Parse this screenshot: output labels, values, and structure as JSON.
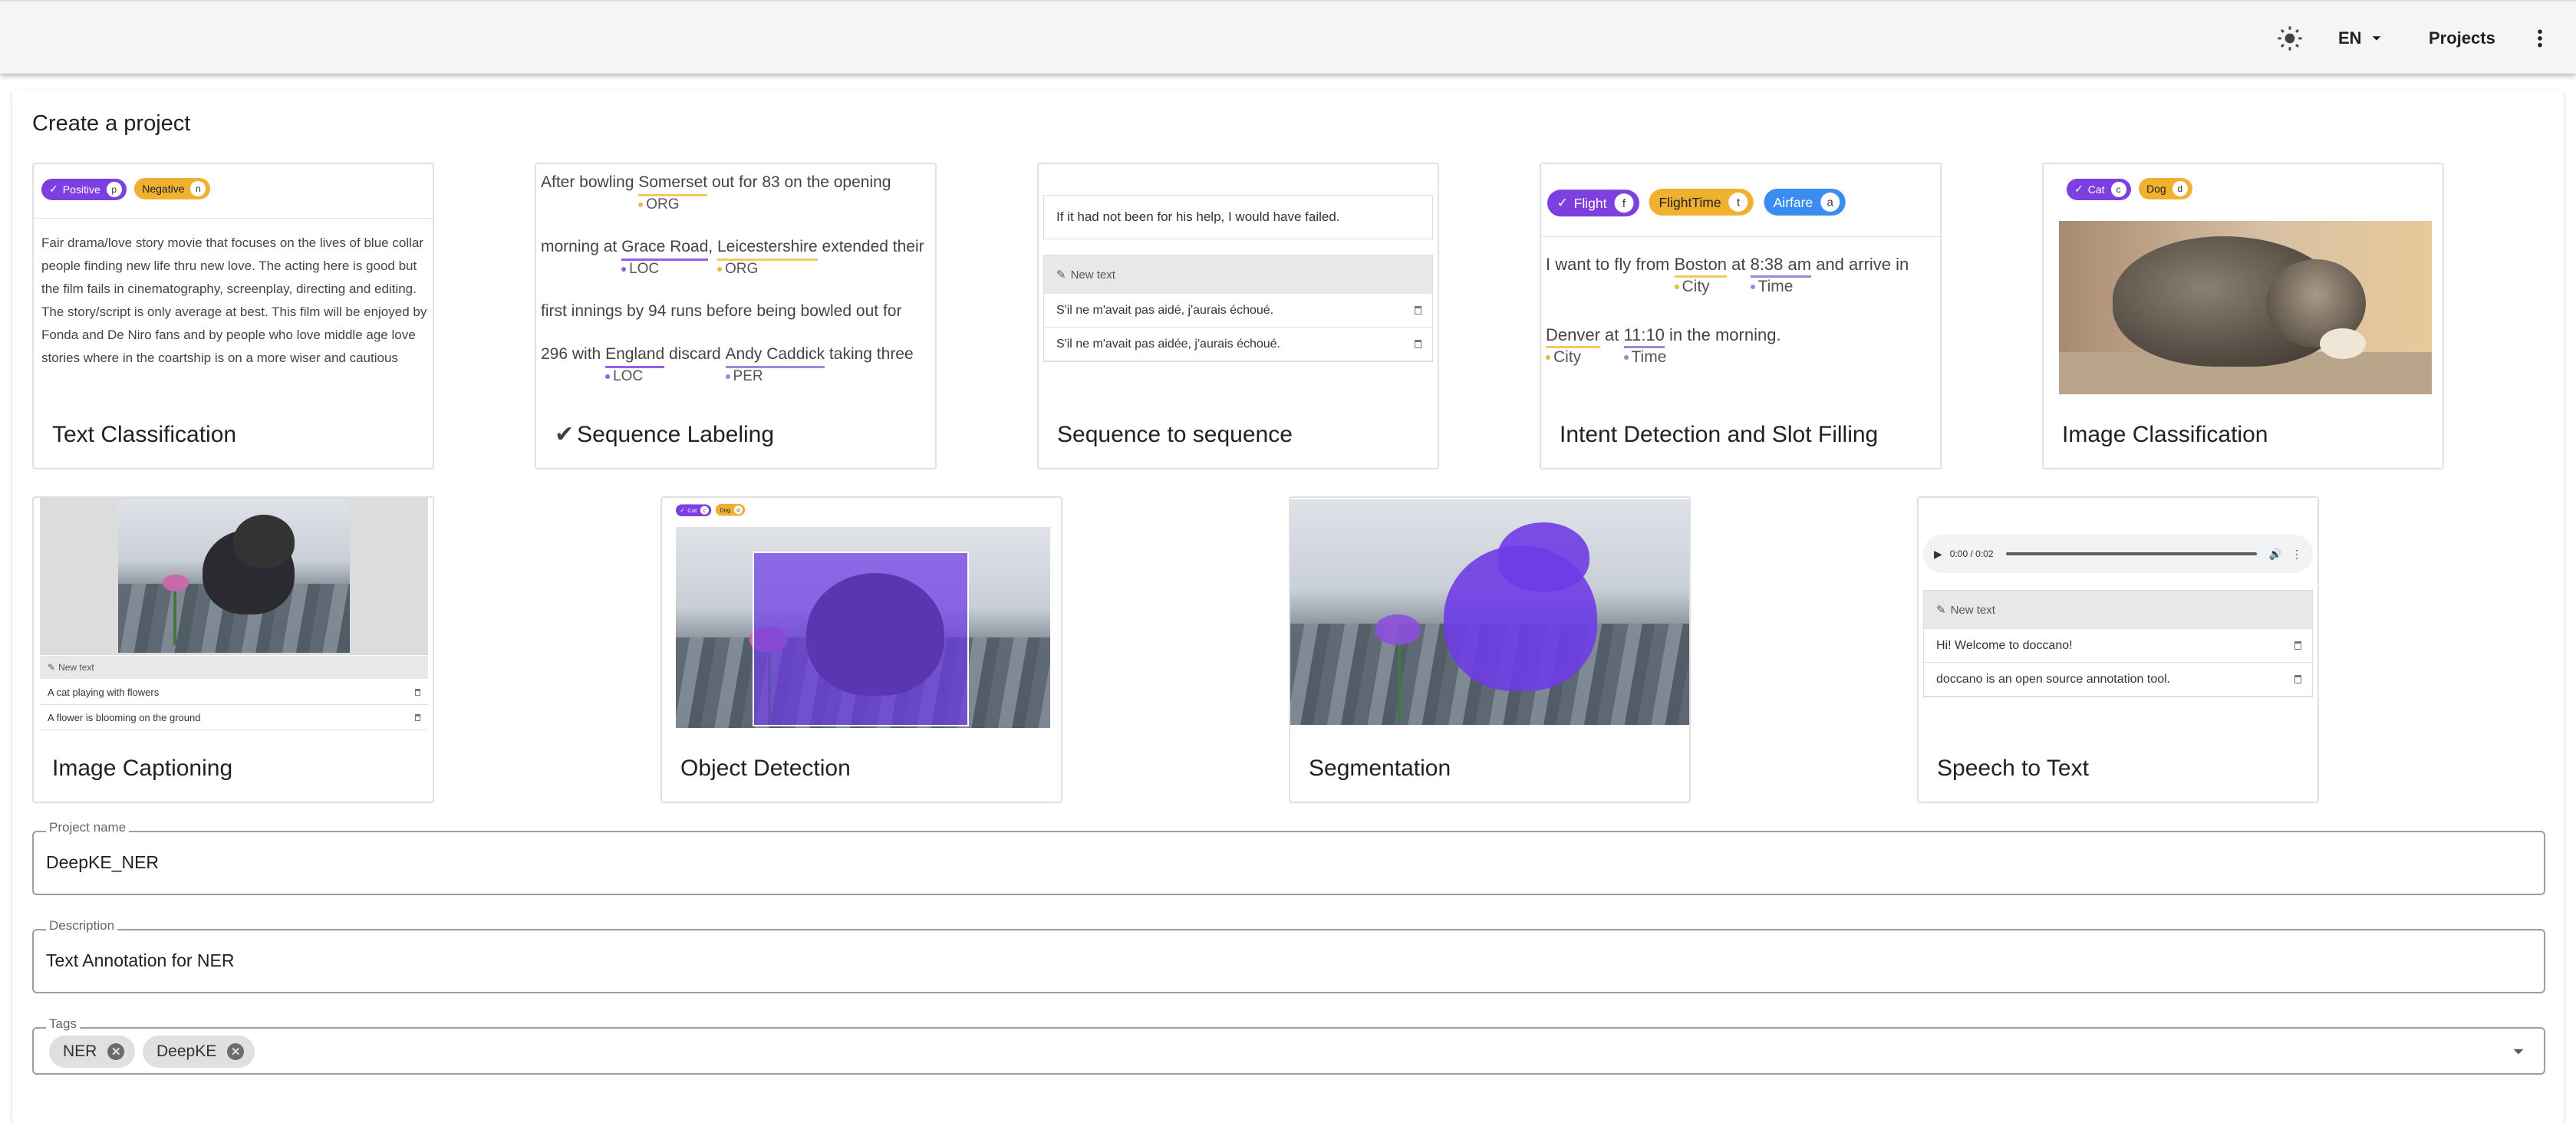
{
  "appbar": {
    "theme_icon": "sun-icon",
    "language": "EN",
    "projects_label": "Projects",
    "menu_icon": "dots-vertical-icon"
  },
  "page": {
    "title": "Create a project"
  },
  "cards": {
    "text_classification": {
      "title": "Text Classification",
      "chips": [
        {
          "label": "Positive",
          "key": "p"
        },
        {
          "label": "Negative",
          "key": "n"
        }
      ],
      "text": "Fair drama/love story movie that focuses on the lives of blue collar people finding new life thru new love. The acting here is good but the film fails in cinematography, screenplay, directing and editing. The story/script is only average at best. This film will be enjoyed by Fonda and De Niro fans and by people who love middle age love stories where in the coartship is on a more wiser and cautious"
    },
    "sequence_labeling": {
      "title": "Sequence Labeling",
      "line1_pre": "After bowling ",
      "line1_ent": "Somerset",
      "line1_ent_label": "ORG",
      "line1_post": " out for 83 on the opening",
      "line2_pre": "morning at ",
      "line2_ent1": "Grace Road",
      "line2_ent1_label": "LOC",
      "line2_mid": ", ",
      "line2_ent2": "Leicestershire",
      "line2_ent2_label": "ORG",
      "line2_post": " extended their",
      "line3": "first innings by 94 runs before being bowled out for",
      "line4_pre": "296 with ",
      "line4_ent1": "England",
      "line4_ent1_label": "LOC",
      "line4_mid": " discard ",
      "line4_ent2": "Andy Caddick",
      "line4_ent2_label": "PER",
      "line4_post": " taking three"
    },
    "seq2seq": {
      "title": "Sequence to sequence",
      "source": "If it had not been for his help, I would have failed.",
      "new_text": "New text",
      "rows": [
        "S'il ne m'avait pas aidé, j'aurais échoué.",
        "S'il ne m'avait pas aidée, j'aurais échoué."
      ]
    },
    "intent": {
      "title": "Intent Detection and Slot Filling",
      "chips": [
        {
          "label": "Flight",
          "key": "f"
        },
        {
          "label": "FlightTime",
          "key": "t"
        },
        {
          "label": "Airfare",
          "key": "a"
        }
      ],
      "l1_pre": "I want to fly from ",
      "l1_ent1": "Boston",
      "l1_ent1_label": "City",
      "l1_mid": " at ",
      "l1_ent2": "8:38 am",
      "l1_ent2_label": "Time",
      "l1_post": " and arrive in",
      "l2_ent1": "Denver",
      "l2_ent1_label": "City",
      "l2_mid": " at ",
      "l2_ent2": "11:10",
      "l2_ent2_label": "Time",
      "l2_post": " in the morning."
    },
    "image_classification": {
      "title": "Image Classification",
      "chips": [
        {
          "label": "Cat",
          "key": "c"
        },
        {
          "label": "Dog",
          "key": "d"
        }
      ]
    },
    "image_captioning": {
      "title": "Image Captioning",
      "new_text": "New text",
      "rows": [
        "A cat playing with flowers",
        "A flower is blooming on the ground"
      ]
    },
    "object_detection": {
      "title": "Object Detection",
      "chips": [
        {
          "label": "Cat",
          "key": "c"
        },
        {
          "label": "Dog",
          "key": "d"
        }
      ]
    },
    "segmentation": {
      "title": "Segmentation"
    },
    "speech_to_text": {
      "title": "Speech to Text",
      "time": "0:00 / 0:02",
      "new_text": "New text",
      "rows": [
        "Hi! Welcome to doccano!",
        "doccano is an open source annotation tool."
      ]
    }
  },
  "form": {
    "project_name": {
      "label": "Project name",
      "value": "DeepKE_NER"
    },
    "description": {
      "label": "Description",
      "value": "Text Annotation for NER"
    },
    "tags": {
      "label": "Tags",
      "items": [
        "NER",
        "DeepKE"
      ]
    }
  },
  "colors": {
    "purple": "#7e3fe0",
    "orange": "#f0b030",
    "blue": "#3b8cf0"
  }
}
